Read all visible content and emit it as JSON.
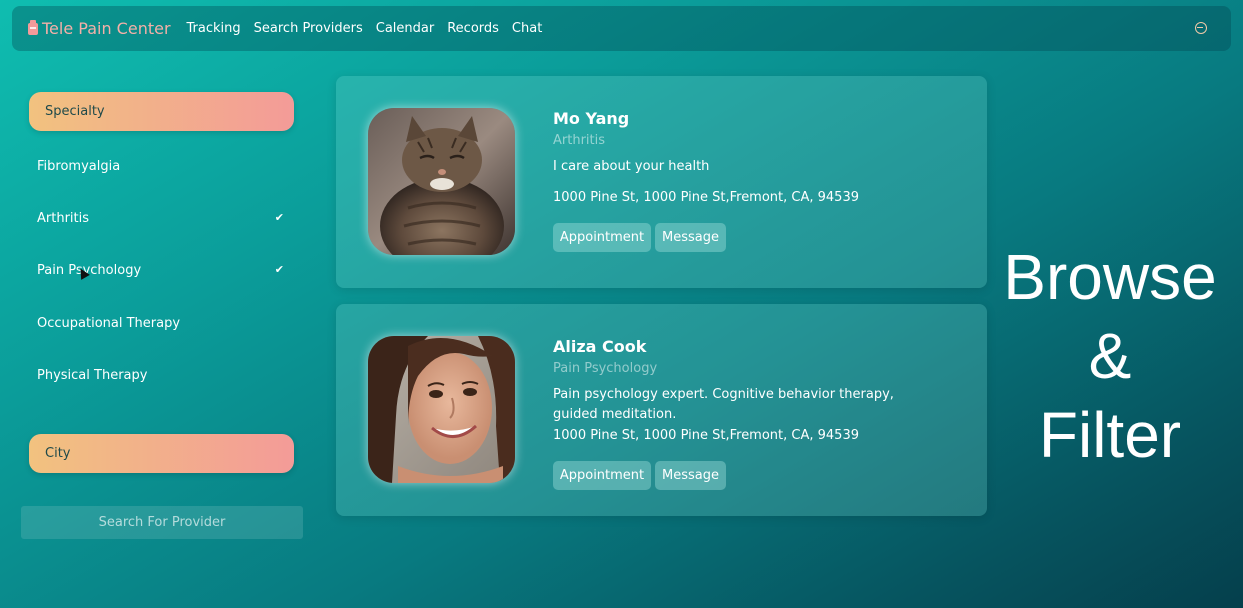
{
  "app": {
    "brand": "Tele Pain Center",
    "nav": [
      "Tracking",
      "Search Providers",
      "Calendar",
      "Records",
      "Chat"
    ],
    "logout_icon": "logout-icon"
  },
  "sidebar": {
    "specialty_label": "Specialty",
    "specialties": [
      {
        "label": "Fibromyalgia",
        "checked": false
      },
      {
        "label": "Arthritis",
        "checked": true
      },
      {
        "label": "Pain Psychology",
        "checked": true
      },
      {
        "label": "Occupational Therapy",
        "checked": false
      },
      {
        "label": "Physical Therapy",
        "checked": false
      }
    ],
    "check_glyph": "✔",
    "city_label": "City",
    "search_button": "Search For Provider"
  },
  "providers": [
    {
      "name": "Mo Yang",
      "specialty": "Arthritis",
      "bio": "I care about your health",
      "address": "1000 Pine St, 1000 Pine St,Fremont, CA, 94539",
      "appointment_label": "Appointment",
      "message_label": "Message",
      "photo": "cat-photo"
    },
    {
      "name": "Aliza Cook",
      "specialty": "Pain Psychology",
      "bio": "Pain psychology expert. Cognitive behavior therapy, guided meditation.",
      "address": "1000 Pine St, 1000 Pine St,Fremont, CA, 94539",
      "appointment_label": "Appointment",
      "message_label": "Message",
      "photo": "woman-photo"
    }
  ],
  "tagline": [
    "Browse",
    "&",
    "Filter"
  ],
  "colors": {
    "pill_gradient_start": "#f2c27f",
    "pill_gradient_end": "#f39b98",
    "brand": "#f4b0a8"
  }
}
